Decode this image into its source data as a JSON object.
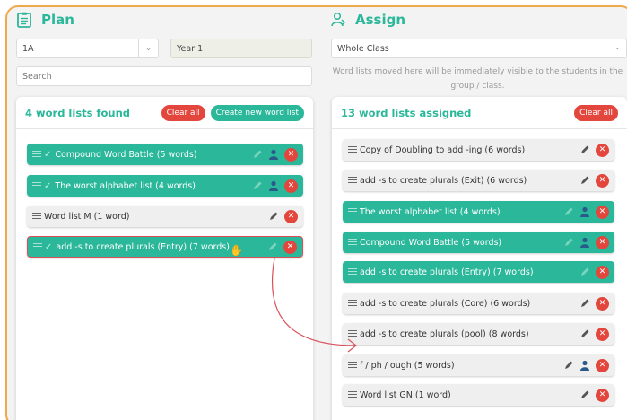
{
  "plan": {
    "title": "Plan",
    "class_value": "1A",
    "year_value": "Year 1",
    "search_placeholder": "Search",
    "count_label": "4 word lists found",
    "clear_all": "Clear all",
    "create_new": "Create new word list",
    "items": [
      {
        "label": "Compound Word Battle (5 words)",
        "style": "green",
        "checked": true
      },
      {
        "label": "The worst alphabet list (4 words)",
        "style": "green",
        "checked": true
      },
      {
        "label": "Word list M (1 word)",
        "style": "grey",
        "checked": false
      },
      {
        "label": "add -s to create plurals (Entry) (7 words)",
        "style": "green",
        "checked": true
      }
    ]
  },
  "assign": {
    "title": "Assign",
    "target_value": "Whole Class",
    "info_text": "Word lists moved here will be immediately visible to the students in the group / class.",
    "count_label": "13 word lists assigned",
    "clear_all": "Clear all",
    "items": [
      {
        "label": "Copy of Doubling to add -ing (6 words)",
        "style": "grey"
      },
      {
        "label": "add -s to create plurals (Exit) (6 words)",
        "style": "grey"
      },
      {
        "label": "The worst alphabet list (4 words)",
        "style": "green"
      },
      {
        "label": "Compound Word Battle (5 words)",
        "style": "green"
      },
      {
        "label": "add -s to create plurals (Entry) (7 words)",
        "style": "green"
      },
      {
        "label": "add -s to create plurals (Core) (6 words)",
        "style": "grey"
      },
      {
        "label": "add -s to create plurals (pool) (8 words)",
        "style": "grey"
      },
      {
        "label": "f / ph / ough (5 words)",
        "style": "grey"
      },
      {
        "label": "Word list GN (1 word)",
        "style": "grey"
      }
    ]
  },
  "colors": {
    "accent": "#2bb79a",
    "danger": "#e2463c",
    "frame": "#f0a94a"
  }
}
